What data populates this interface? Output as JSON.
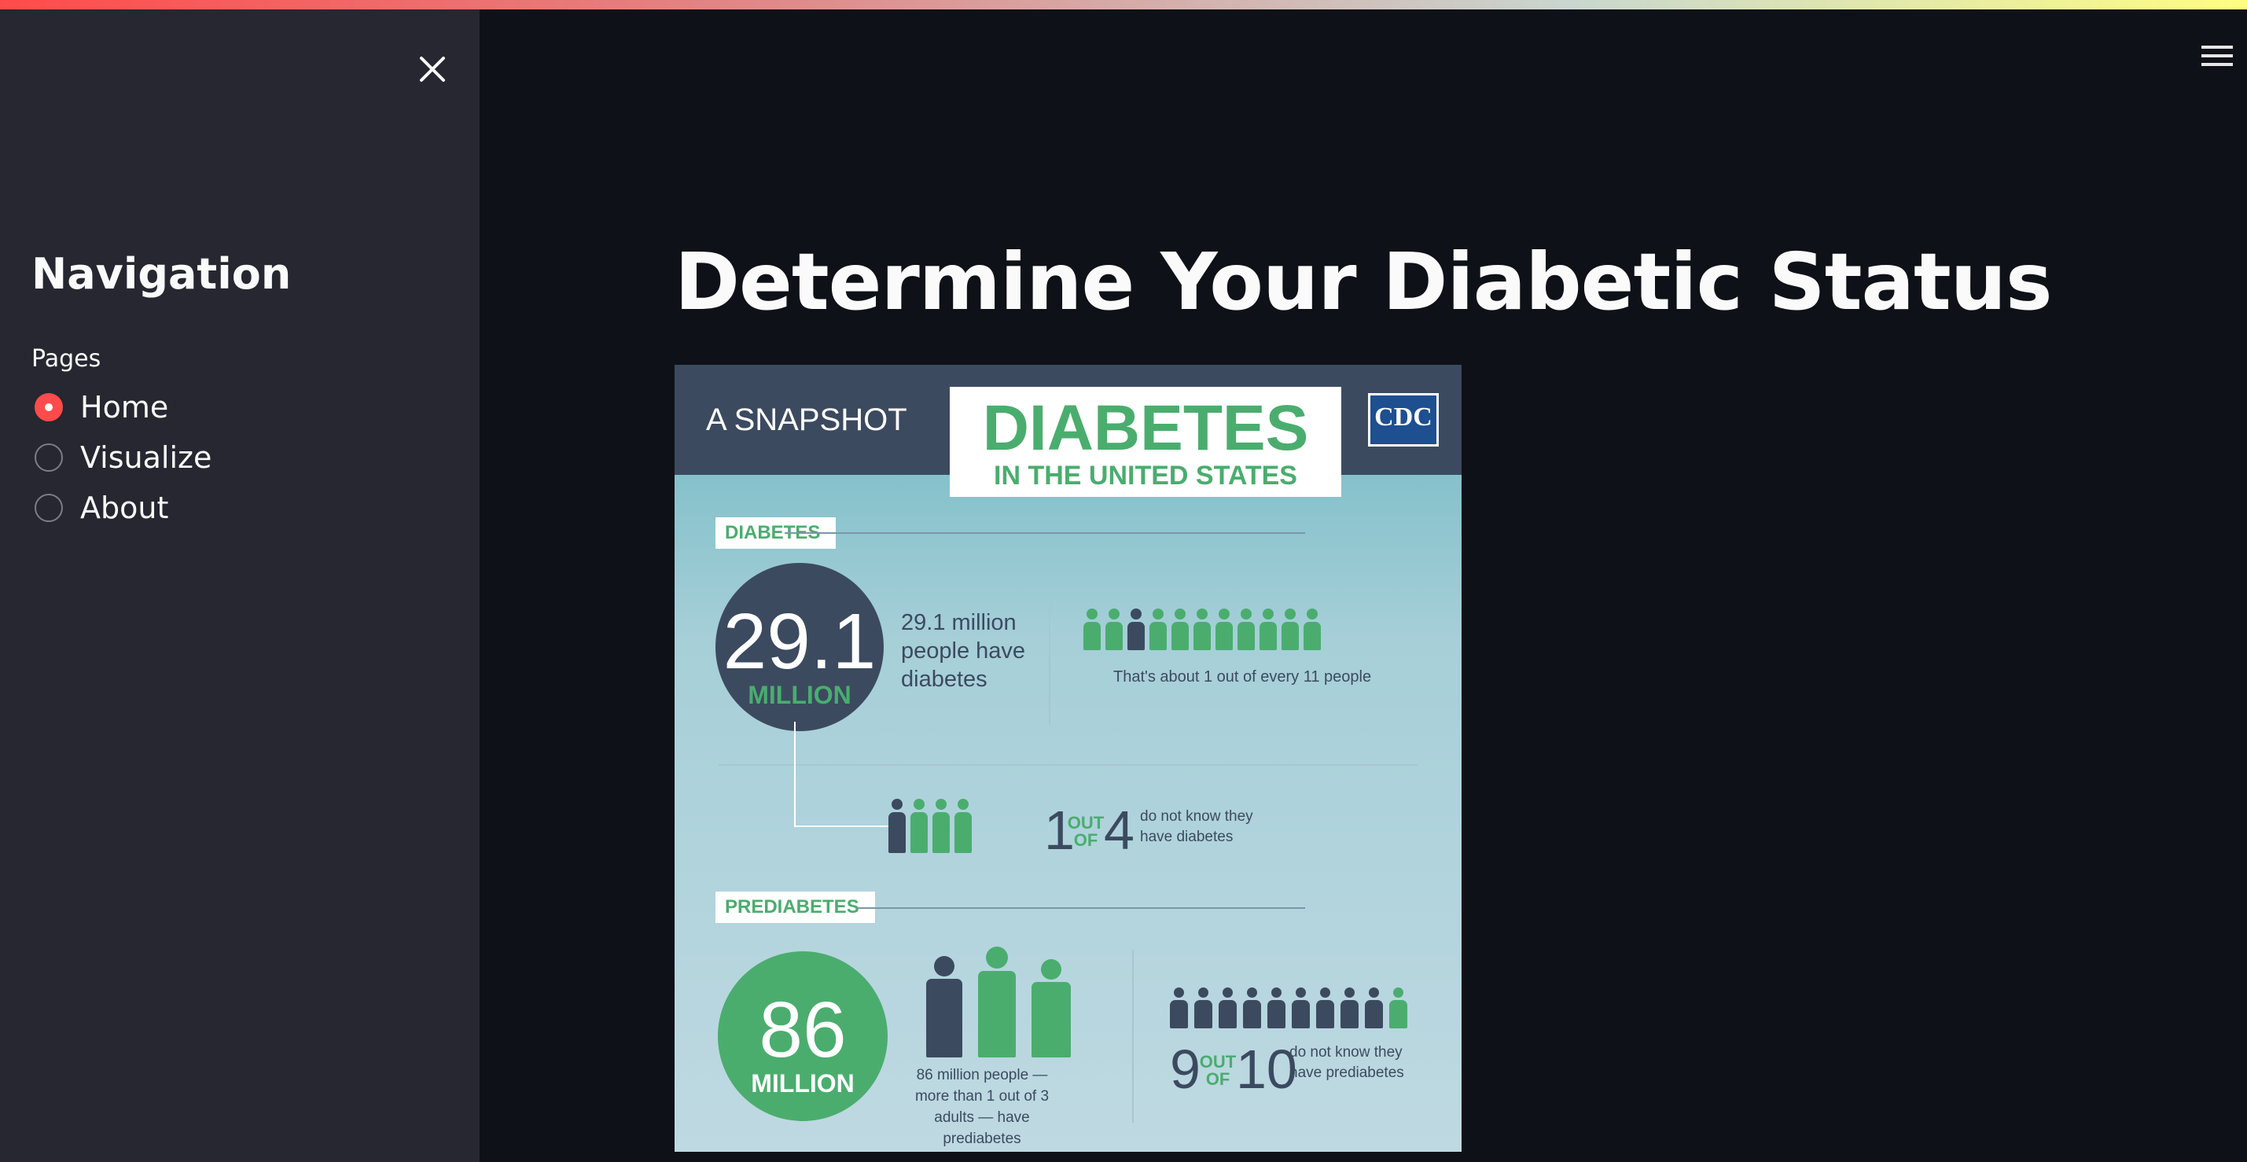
{
  "sidebar": {
    "title": "Navigation",
    "pages_label": "Pages",
    "options": [
      {
        "label": "Home",
        "selected": true
      },
      {
        "label": "Visualize",
        "selected": false
      },
      {
        "label": "About",
        "selected": false
      }
    ]
  },
  "main": {
    "title": "Determine Your Diabetic Status"
  },
  "infographic": {
    "snapshot": "A SNAPSHOT",
    "title": "DIABETES",
    "subtitle": "IN THE UNITED STATES",
    "logo_text": "CDC",
    "section1_tag": "DIABETES",
    "diabetes_number": "29.1",
    "diabetes_unit": "MILLION",
    "diabetes_text": "29.1 million people have diabetes",
    "ratio_text": "That's about 1 out of every 11 people",
    "unaware_num1": "1",
    "unaware_outof": "OUT OF",
    "unaware_num2": "4",
    "unaware_text": "do not know they have diabetes",
    "section2_tag": "PREDIABETES",
    "prediabetes_number": "86",
    "prediabetes_unit": "MILLION",
    "prediabetes_text": "86 million people — more than 1 out of 3 adults — have prediabetes",
    "pre_num1": "9",
    "pre_outof": "OUT OF",
    "pre_num2": "10",
    "pre_unaware_text": "do not know they have prediabetes"
  },
  "colors": {
    "accent": "#ff4b4b",
    "sidebar_bg": "#262730",
    "main_bg": "#0e1117",
    "info_green": "#4aad6e",
    "info_dark": "#3c4a60"
  },
  "icons": {
    "close": "close-icon",
    "menu": "hamburger-menu-icon"
  }
}
